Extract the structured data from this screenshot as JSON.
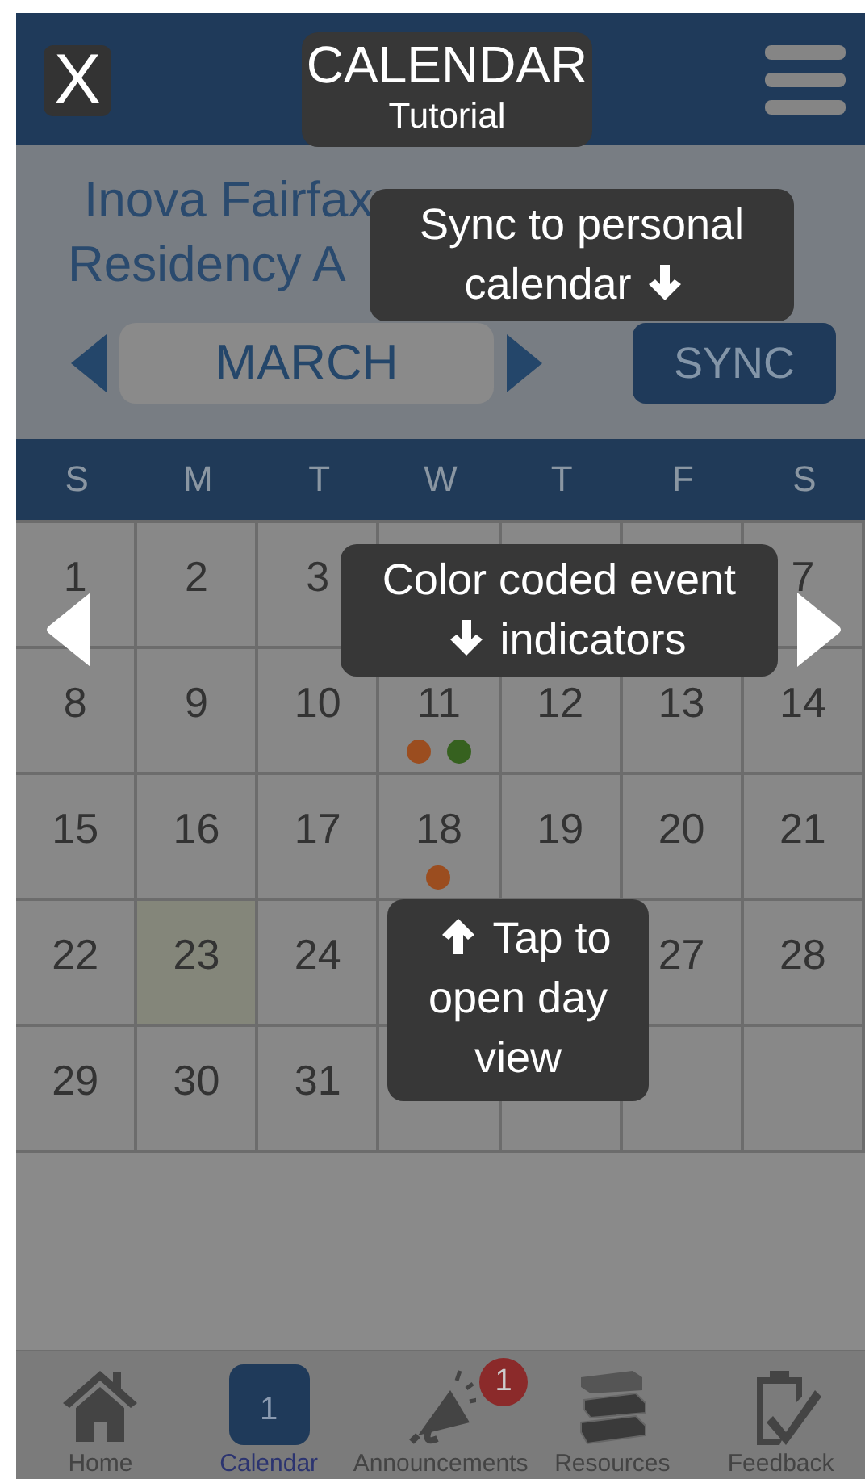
{
  "calendar": {
    "title_lines": [
      "Inova Fairfax",
      "Residency A"
    ],
    "month": "MARCH",
    "sync_button": "SYNC",
    "weekdays": [
      "S",
      "M",
      "T",
      "W",
      "T",
      "F",
      "S"
    ],
    "days": [
      {
        "kind": "day",
        "label": "1",
        "today": false
      },
      {
        "kind": "day",
        "label": "2",
        "today": false
      },
      {
        "kind": "day",
        "label": "3",
        "today": false
      },
      {
        "kind": "covered"
      },
      {
        "kind": "covered"
      },
      {
        "kind": "covered"
      },
      {
        "kind": "day",
        "label": "7",
        "today": false
      },
      {
        "kind": "day",
        "label": "8",
        "today": false
      },
      {
        "kind": "day",
        "label": "9",
        "today": false
      },
      {
        "kind": "day",
        "label": "10",
        "today": false
      },
      {
        "kind": "day",
        "label": "11",
        "today": false,
        "events": [
          {
            "color": "#9b4d1f"
          },
          {
            "color": "#36611f"
          }
        ]
      },
      {
        "kind": "day",
        "label": "12",
        "today": false
      },
      {
        "kind": "day",
        "label": "13",
        "today": false
      },
      {
        "kind": "day",
        "label": "14",
        "today": false
      },
      {
        "kind": "day",
        "label": "15",
        "today": false
      },
      {
        "kind": "day",
        "label": "16",
        "today": false
      },
      {
        "kind": "day",
        "label": "17",
        "today": false
      },
      {
        "kind": "day",
        "label": "18",
        "today": false,
        "events": [
          {
            "color": "#9b4d1f"
          }
        ]
      },
      {
        "kind": "day",
        "label": "19",
        "today": false
      },
      {
        "kind": "day",
        "label": "20",
        "today": false
      },
      {
        "kind": "day",
        "label": "21",
        "today": false
      },
      {
        "kind": "day",
        "label": "22",
        "today": false
      },
      {
        "kind": "day",
        "label": "23",
        "today": true
      },
      {
        "kind": "day",
        "label": "24",
        "today": false
      },
      {
        "kind": "covered"
      },
      {
        "kind": "hidden"
      },
      {
        "kind": "day",
        "label": "27",
        "today": false
      },
      {
        "kind": "day",
        "label": "28",
        "today": false
      },
      {
        "kind": "day",
        "label": "29",
        "today": false
      },
      {
        "kind": "day",
        "label": "30",
        "today": false
      },
      {
        "kind": "day",
        "label": "31",
        "today": false
      }
    ]
  },
  "tab_bar": [
    {
      "label": "Home",
      "kind": "home",
      "selected": false
    },
    {
      "label": "Calendar",
      "kind": "calendar",
      "selected": true,
      "icon_text": "1"
    },
    {
      "label": "Announcements",
      "kind": "megaphone",
      "selected": false,
      "badge": "1"
    },
    {
      "label": "Resources",
      "kind": "books",
      "selected": false
    },
    {
      "label": "Feedback",
      "kind": "clipboard",
      "selected": false
    }
  ],
  "tutorial": {
    "close": "X",
    "title": "CALENDAR",
    "subtitle": "Tutorial",
    "tips": [
      {
        "parts": [
          {
            "kind": "text",
            "text": "Sync to personal"
          },
          {
            "kind": "break"
          },
          {
            "kind": "text",
            "text": "calendar"
          },
          {
            "kind": "arrow_down"
          }
        ]
      },
      {
        "parts": [
          {
            "kind": "text",
            "text": "Color coded event"
          },
          {
            "kind": "break"
          },
          {
            "kind": "arrow_down"
          },
          {
            "kind": "text",
            "text": "indicators"
          }
        ]
      },
      {
        "parts": [
          {
            "kind": "arrow_up"
          },
          {
            "kind": "text",
            "text": "Tap to"
          },
          {
            "kind": "break"
          },
          {
            "kind": "text",
            "text": "open day view"
          }
        ]
      }
    ]
  }
}
